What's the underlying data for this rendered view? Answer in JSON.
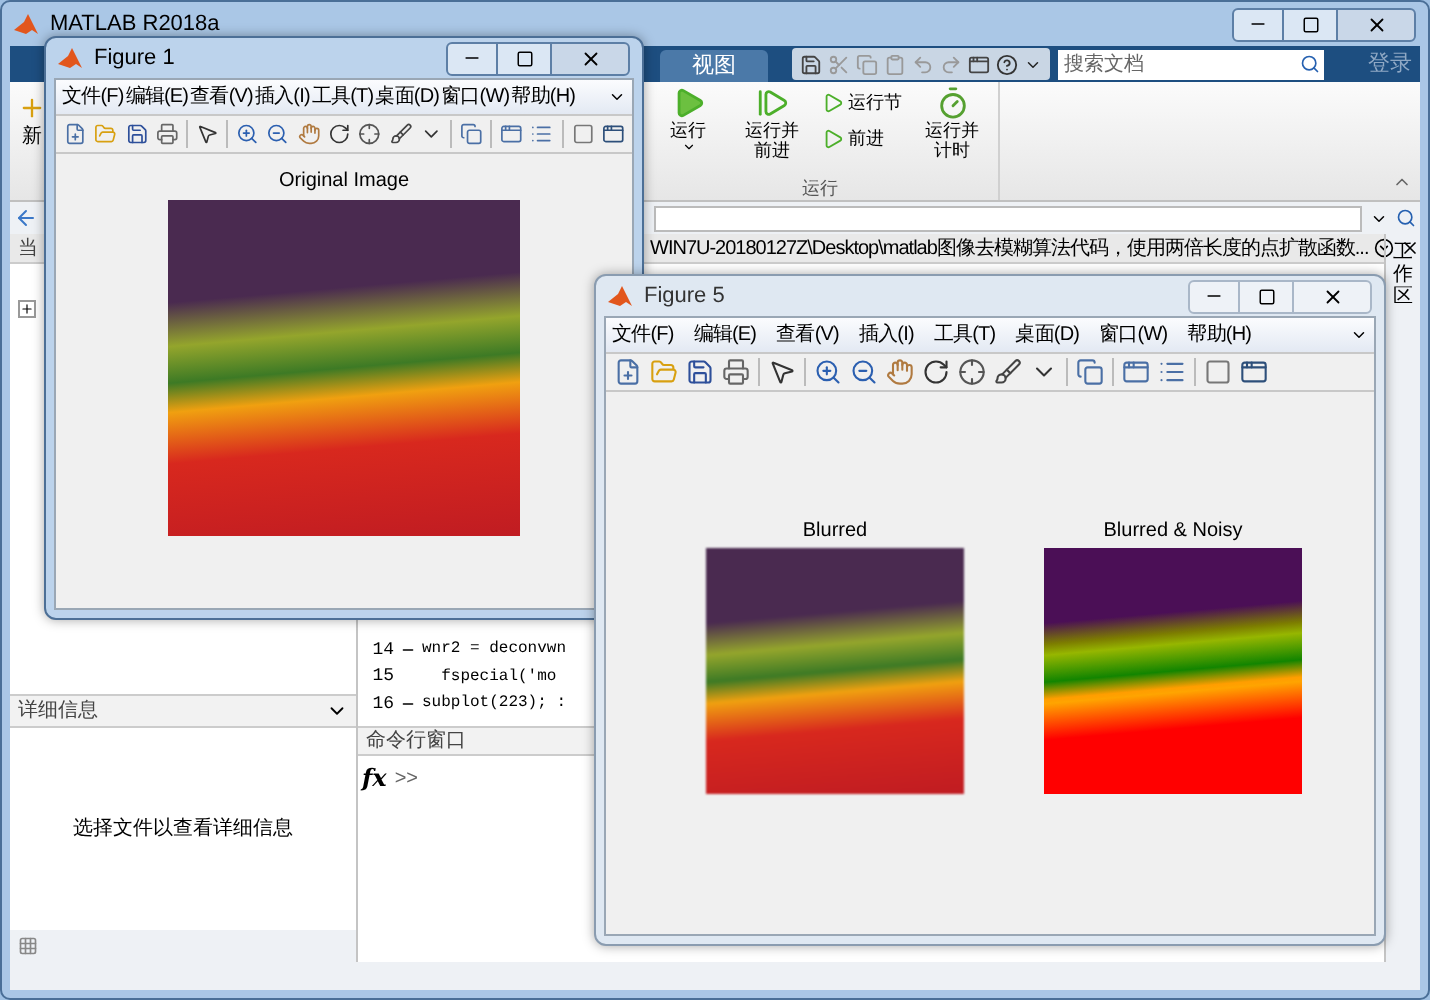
{
  "main_window": {
    "title": "MATLAB R2018a",
    "tab": {
      "label": "视图",
      "selected": false
    },
    "search": {
      "placeholder": "搜索文档"
    },
    "login": "登录",
    "ribbon_left": "新",
    "run_group": {
      "label": "运行",
      "items": [
        {
          "kind": "large",
          "label": "运行",
          "dropdown": true
        },
        {
          "kind": "large",
          "label": "运行并前进",
          "dropdown": false
        },
        {
          "kind": "small",
          "label": "运行节"
        },
        {
          "kind": "small",
          "label": "前进"
        },
        {
          "kind": "large",
          "label": "运行并计时",
          "dropdown": false
        }
      ]
    },
    "folder_header": "当",
    "path": "WIN7U-20180127Z\\Desktop\\matlab图像去模糊算法代码，使用两倍长度的点扩散函数...",
    "side_panel": "工作区",
    "details": {
      "title": "详细信息",
      "message": "选择文件以查看详细信息"
    },
    "editor_lines": [
      {
        "number": "14",
        "dash": true,
        "code": "wnr2 = deconvwn"
      },
      {
        "number": "15",
        "dash": false,
        "code": "  fspecial('mo"
      },
      {
        "number": "16",
        "dash": true,
        "code": "subplot(223); :"
      }
    ],
    "command_window": {
      "title": "命令行窗口",
      "function_label": "fx",
      "prompt": ">>"
    }
  },
  "figures": [
    {
      "title": "Figure 1",
      "active": true,
      "menu": [
        "文件(F)",
        "编辑(E)",
        "查看(V)",
        "插入(I)",
        "工具(T)",
        "桌面(D)",
        "窗口(W)",
        "帮助(H)"
      ],
      "axes": [
        {
          "title": "Original Image"
        }
      ]
    },
    {
      "title": "Figure 5",
      "active": false,
      "menu": [
        "文件(F)",
        "编辑(E)",
        "查看(V)",
        "插入(I)",
        "工具(T)",
        "桌面(D)",
        "窗口(W)",
        "帮助(H)"
      ],
      "axes": [
        {
          "title": "Blurred"
        },
        {
          "title": "Blurred & Noisy"
        }
      ]
    }
  ]
}
